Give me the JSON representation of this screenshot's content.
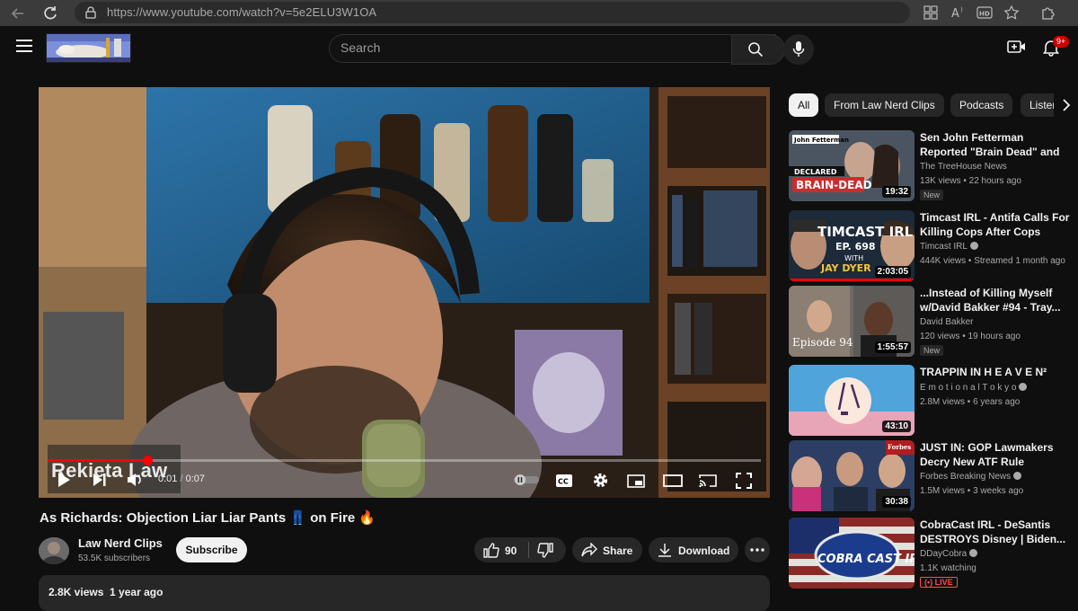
{
  "browser": {
    "url": "https://www.youtube.com/watch?v=5e2ELU3W1OA"
  },
  "header": {
    "search_placeholder": "Search",
    "notifications_badge": "9+"
  },
  "player": {
    "watermark": "Rekieta Law",
    "current_time": "0:01",
    "separator": "/",
    "duration": "0:07",
    "progress": 0.14,
    "cc_label": "CC"
  },
  "video": {
    "title": "As Richards: Objection Liar Liar Pants 👖 on Fire 🔥",
    "channel_name": "Law Nerd Clips",
    "subscribers": "53.5K subscribers",
    "subscribe_label": "Subscribe",
    "likes": "90",
    "share_label": "Share",
    "download_label": "Download",
    "views": "2.8K views",
    "age": "1 year ago"
  },
  "chips": [
    {
      "label": "All",
      "active": true
    },
    {
      "label": "From Law Nerd Clips",
      "active": false
    },
    {
      "label": "Podcasts",
      "active": false
    },
    {
      "label": "Listen",
      "active": false
    }
  ],
  "recommendations": [
    {
      "title": "Sen John Fetterman Reported \"Brain Dead\" and Wife Runs T...",
      "channel": "The TreeHouse News",
      "verified": false,
      "views": "13K views",
      "age": "22 hours ago",
      "duration": "19:32",
      "badge": "New",
      "thumb_top_text": "John Fetterman",
      "thumb_text_1": "DECLARED",
      "thumb_text_2": "BRAIN-DEAD"
    },
    {
      "title": "Timcast IRL - Antifa Calls For Killing Cops After Cops Kills...",
      "channel": "Timcast IRL",
      "verified": true,
      "views": "444K views",
      "age": "Streamed 1 month ago",
      "duration": "2:03:05",
      "badge": "",
      "thumb_text_1": "TIMCAST IRL",
      "thumb_text_2": "EP. 698",
      "thumb_text_3": "WITH",
      "thumb_text_4": "JAY DYER"
    },
    {
      "title": "...Instead of Killing Myself w/David Bakker #94 - Tray...",
      "channel": "David Bakker",
      "verified": false,
      "views": "120 views",
      "age": "19 hours ago",
      "duration": "1:55:57",
      "badge": "New",
      "thumb_text_1": "Episode 94"
    },
    {
      "title": "TRAPPIN IN H E A V E N²",
      "channel": "E m o t i o n a l T o k y o",
      "verified": true,
      "views": "2.8M views",
      "age": "6 years ago",
      "duration": "43:10",
      "badge": ""
    },
    {
      "title": "JUST IN: GOP Lawmakers Decry New ATF Rule Requirin...",
      "channel": "Forbes Breaking News",
      "verified": true,
      "views": "1.5M views",
      "age": "3 weeks ago",
      "duration": "30:38",
      "badge": "",
      "thumb_text_1": "Forbes"
    },
    {
      "title": "CobraCast IRL - DeSantis DESTROYS Disney | Biden...",
      "channel": "DDayCobra",
      "verified": true,
      "views": "1.1K watching",
      "age": "",
      "duration": "",
      "badge": "LIVE",
      "thumb_text_1": "COBRA CAST IRL"
    }
  ],
  "colors": {
    "background": "#0f0f0f",
    "accent_red": "#ff0000",
    "live_red": "#ff4e45",
    "surface": "#272727"
  },
  "icons": [
    "back-icon",
    "reload-icon",
    "lock-icon",
    "apps-icon",
    "read-aloud-icon",
    "hd-icon",
    "favorites-icon",
    "extensions-icon",
    "menu-icon",
    "search-icon",
    "mic-icon",
    "create-icon",
    "bell-icon",
    "play-icon",
    "next-icon",
    "volume-icon",
    "autoplay-icon",
    "captions-icon",
    "settings-icon",
    "miniplayer-icon",
    "theater-icon",
    "cast-icon",
    "fullscreen-icon",
    "like-icon",
    "dislike-icon",
    "share-icon",
    "download-icon",
    "more-icon",
    "chevron-right-icon",
    "verified-icon"
  ]
}
